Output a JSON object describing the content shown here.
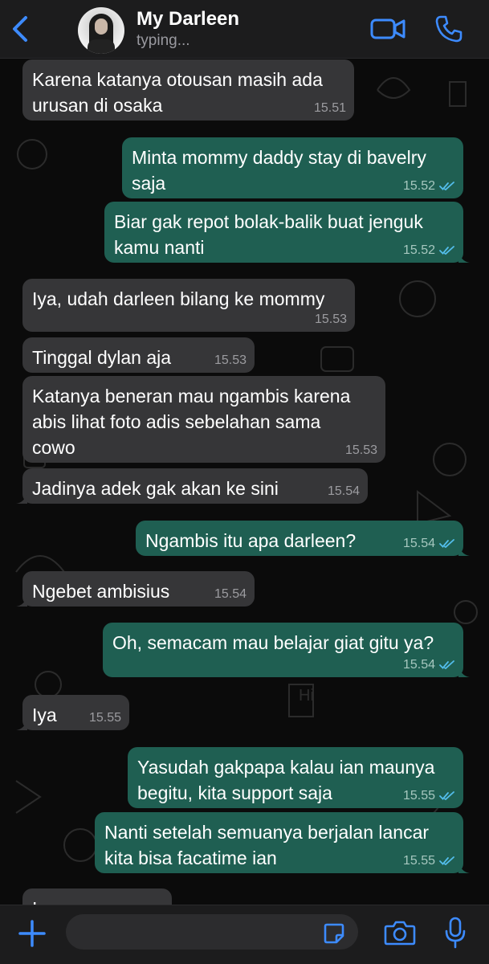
{
  "header": {
    "contact_name": "My Darleen",
    "status": "typing..."
  },
  "colors": {
    "accent": "#3d8bff",
    "incoming_bubble": "#363638",
    "outgoing_bubble": "#1f5f52",
    "read_ticks": "#53bdeb"
  },
  "icons": {
    "back": "chevron-left-icon",
    "video": "video-camera-icon",
    "call": "phone-icon",
    "add": "plus-icon",
    "sticker": "sticker-icon",
    "camera": "camera-icon",
    "mic": "microphone-icon"
  },
  "messages": [
    {
      "direction": "in",
      "text": "Karena katanya otousan masih ada\nurusan di osaka",
      "time": "15.51"
    },
    {
      "direction": "out",
      "text": "Minta mommy daddy stay di bavelry\nsaja",
      "time": "15.52",
      "read": true
    },
    {
      "direction": "out",
      "text": "Biar gak repot bolak-balik buat jenguk\nkamu nanti",
      "time": "15.52",
      "read": true
    },
    {
      "direction": "in",
      "text": "Iya, udah darleen bilang ke mommy",
      "time": "15.53"
    },
    {
      "direction": "in",
      "text": "Tinggal dylan aja",
      "time": "15.53"
    },
    {
      "direction": "in",
      "text": "Katanya beneran mau ngambis karena\nabis lihat foto adis sebelahan sama\ncowo",
      "time": "15.53"
    },
    {
      "direction": "in",
      "text": "Jadinya adek gak akan ke sini",
      "time": "15.54"
    },
    {
      "direction": "out",
      "text": "Ngambis itu apa darleen?",
      "time": "15.54",
      "read": true
    },
    {
      "direction": "in",
      "text": "Ngebet ambisius",
      "time": "15.54"
    },
    {
      "direction": "out",
      "text": "Oh, semacam mau belajar giat gitu ya?",
      "time": "15.54",
      "read": true
    },
    {
      "direction": "in",
      "text": "Iya",
      "time": "15.55"
    },
    {
      "direction": "out",
      "text": "Yasudah gakpapa kalau ian maunya\nbegitu, kita support saja",
      "time": "15.55",
      "read": true
    },
    {
      "direction": "out",
      "text": "Nanti setelah semuanya berjalan lancar\nkita bisa facatime ian",
      "time": "15.55",
      "read": true
    },
    {
      "direction": "in",
      "text": "Iya mas",
      "time": ""
    }
  ],
  "composer": {
    "placeholder": ""
  }
}
